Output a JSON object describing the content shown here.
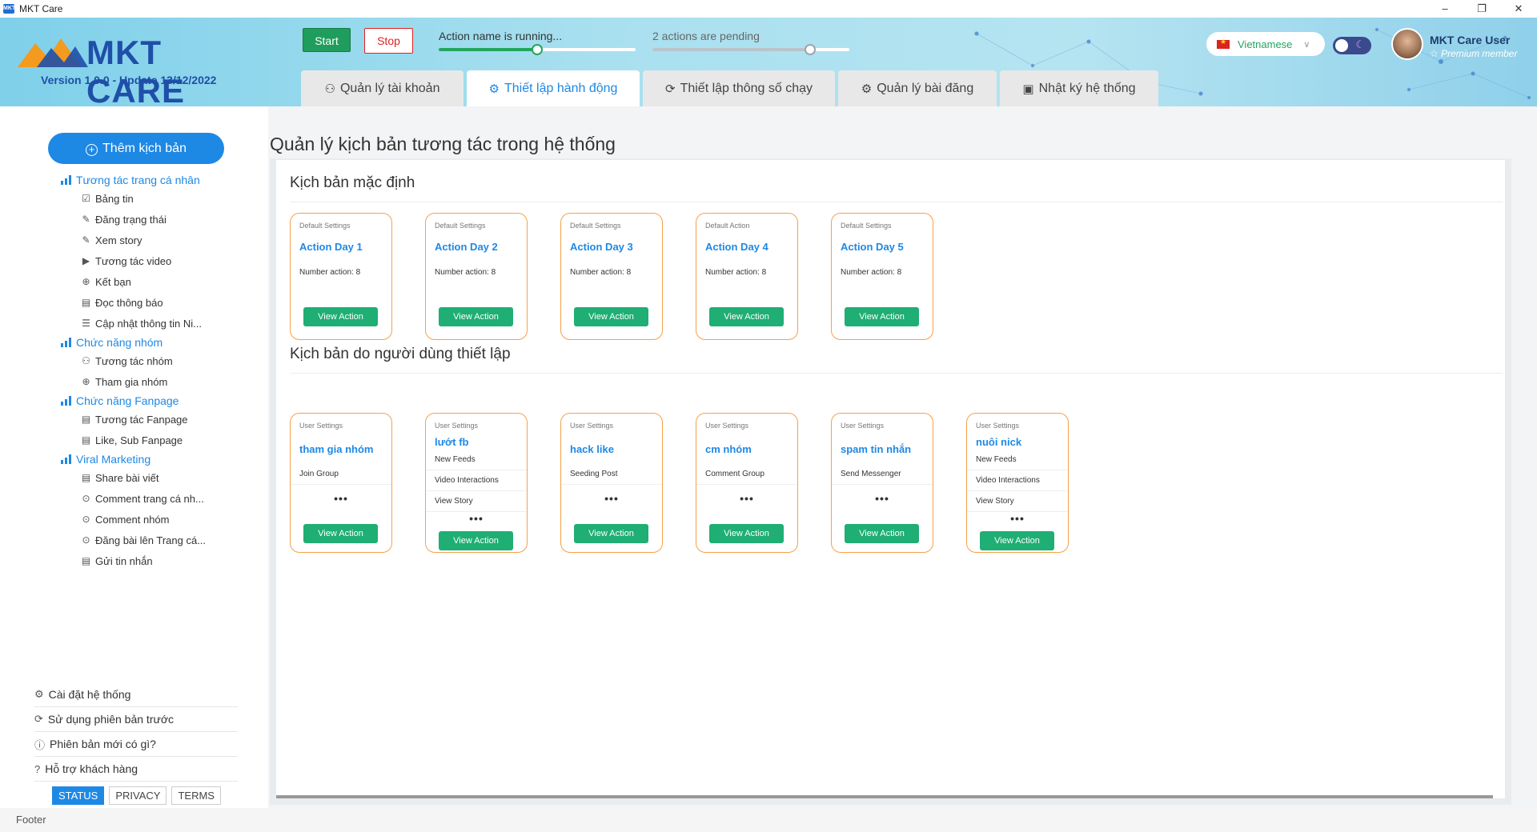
{
  "window": {
    "title": "MKT Care",
    "icon_text": "MKT",
    "controls": [
      "–",
      "❐",
      "✕"
    ]
  },
  "header": {
    "logo_text": "MKT CARE",
    "version": "Version 1.0.0 - Update 13/12/2022",
    "start_label": "Start",
    "stop_label": "Stop",
    "progress1": {
      "label": "Action name is running...",
      "value": 0.5
    },
    "progress2": {
      "label": "2 actions are pending",
      "value": 0.8
    },
    "language": "Vietnamese",
    "user_name": "MKT Care User",
    "user_tier": "☆ Premium member",
    "tabs": [
      {
        "label": "Quản lý tài khoản",
        "icon": "⚇",
        "active": false
      },
      {
        "label": "Thiết lập hành động",
        "icon": "⚙",
        "active": true
      },
      {
        "label": "Thiết lập thông số chạy",
        "icon": "⟳",
        "active": false
      },
      {
        "label": "Quản lý bài đăng",
        "icon": "⚙",
        "active": false
      },
      {
        "label": "Nhật ký hệ thống",
        "icon": "▣",
        "active": false
      }
    ]
  },
  "sidebar": {
    "add_button": "Thêm kịch bản",
    "groups": [
      {
        "label": "Tương tác trang cá nhân",
        "items": [
          {
            "label": "Bảng tin",
            "icon": "☑"
          },
          {
            "label": "Đăng trạng thái",
            "icon": "✎"
          },
          {
            "label": "Xem story",
            "icon": "✎"
          },
          {
            "label": "Tương tác video",
            "icon": "▶"
          },
          {
            "label": "Kết bạn",
            "icon": "⊕"
          },
          {
            "label": "Đọc thông báo",
            "icon": "▤"
          },
          {
            "label": "Cập nhật thông tin Ni...",
            "icon": "☰"
          }
        ]
      },
      {
        "label": "Chức năng nhóm",
        "items": [
          {
            "label": "Tương tác nhóm",
            "icon": "⚇"
          },
          {
            "label": "Tham gia nhóm",
            "icon": "⊕"
          }
        ]
      },
      {
        "label": "Chức năng Fanpage",
        "items": [
          {
            "label": "Tương tác Fanpage",
            "icon": "▤"
          },
          {
            "label": "Like, Sub Fanpage",
            "icon": "▤"
          }
        ]
      },
      {
        "label": "Viral Marketing",
        "items": [
          {
            "label": "Share bài viết",
            "icon": "▤"
          },
          {
            "label": "Comment trang cá nh...",
            "icon": "⊙"
          },
          {
            "label": "Comment nhóm",
            "icon": "⊙"
          },
          {
            "label": "Đăng bài lên Trang cá...",
            "icon": "⊙"
          },
          {
            "label": "Gửi tin nhắn",
            "icon": "▤"
          }
        ]
      }
    ],
    "bottom_links": [
      {
        "label": "Cài đặt hệ thống",
        "icon": "⚙"
      },
      {
        "label": "Sử dụng phiên bản trước",
        "icon": "⟳"
      },
      {
        "label": "Phiên bản mới có gì?",
        "icon": "ⓘ"
      },
      {
        "label": "Hỗ trợ khách hàng",
        "icon": "?"
      }
    ],
    "footer_buttons": [
      "STATUS",
      "PRIVACY",
      "TERMS"
    ]
  },
  "main": {
    "title": "Quản lý kịch bản tương tác trong hệ thống",
    "default_section": {
      "title": "Kịch bản mặc định",
      "cards": [
        {
          "tag": "Default Settings",
          "name": "Action Day 1",
          "info": "Number action: 8",
          "button": "View Action"
        },
        {
          "tag": "Default Settings",
          "name": "Action Day 2",
          "info": "Number action: 8",
          "button": "View Action"
        },
        {
          "tag": "Default Settings",
          "name": "Action Day 3",
          "info": "Number action: 8",
          "button": "View Action"
        },
        {
          "tag": "Default Action",
          "name": "Action Day 4",
          "info": "Number action: 8",
          "button": "View Action"
        },
        {
          "tag": "Default Settings",
          "name": "Action Day 5",
          "info": "Number action: 8",
          "button": "View Action"
        }
      ]
    },
    "user_section": {
      "title": "Kịch bản do người dùng thiết lập",
      "cards": [
        {
          "tag": "User Settings",
          "name": "tham gia nhóm",
          "features": [
            "Join Group"
          ],
          "more": "•••",
          "button": "View Action"
        },
        {
          "tag": "User Settings",
          "name": "lướt fb",
          "features": [
            "New Feeds",
            "Video Interactions",
            "View Story"
          ],
          "more": "•••",
          "button": "View Action"
        },
        {
          "tag": "User Settings",
          "name": "hack like",
          "features": [
            "Seeding Post"
          ],
          "more": "•••",
          "button": "View Action"
        },
        {
          "tag": "User Settings",
          "name": "cm nhóm",
          "features": [
            "Comment Group"
          ],
          "more": "•••",
          "button": "View Action"
        },
        {
          "tag": "User Settings",
          "name": "spam tin nhắn",
          "features": [
            "Send Messenger"
          ],
          "more": "•••",
          "button": "View Action"
        },
        {
          "tag": "User Settings",
          "name": "nuôi nick",
          "features": [
            "New Feeds",
            "Video Interactions",
            "View Story"
          ],
          "more": "•••",
          "button": "View Action"
        }
      ]
    }
  },
  "footer": {
    "text": "Footer"
  },
  "colors": {
    "primary": "#1e88e5",
    "success": "#1fae74",
    "card_border": "#f5a14a",
    "danger": "#e02020"
  }
}
